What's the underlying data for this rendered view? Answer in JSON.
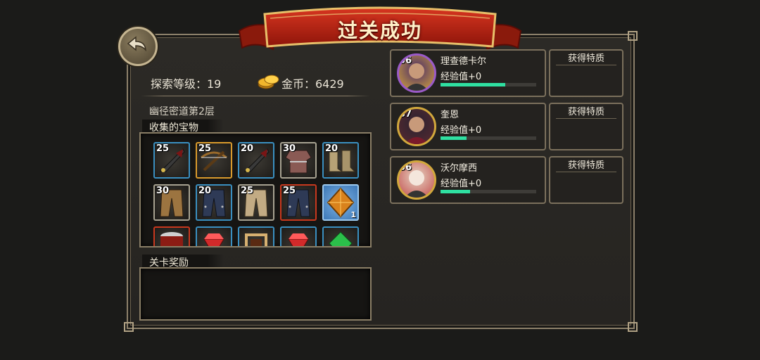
{
  "banner": {
    "title": "过关成功"
  },
  "header": {
    "explore_level": "探索等级：19",
    "gold_label": "金币：6429"
  },
  "stage": {
    "name": "幽径密道第2层"
  },
  "treasures": {
    "label": "收集的宝物",
    "items": [
      {
        "level": "25",
        "rarity": "blue",
        "kind": "weapon"
      },
      {
        "level": "25",
        "rarity": "gold",
        "kind": "crossbow"
      },
      {
        "level": "20",
        "rarity": "blue",
        "kind": "weapon"
      },
      {
        "level": "30",
        "rarity": "gray",
        "kind": "armor"
      },
      {
        "level": "20",
        "rarity": "blue",
        "kind": "boots"
      },
      {
        "level": "30",
        "rarity": "gray",
        "kind": "pants-brown"
      },
      {
        "level": "20",
        "rarity": "blue",
        "kind": "pants-dark"
      },
      {
        "level": "25",
        "rarity": "gray",
        "kind": "pants-light"
      },
      {
        "level": "25",
        "rarity": "red",
        "kind": "pants-dark"
      },
      {
        "level": "",
        "rarity": "bright",
        "kind": "amber-gem",
        "count": "1"
      },
      {
        "level": "",
        "rarity": "red",
        "kind": "red-drum"
      },
      {
        "level": "",
        "rarity": "blue",
        "kind": "ruby"
      },
      {
        "level": "",
        "rarity": "blue",
        "kind": "frame"
      },
      {
        "level": "",
        "rarity": "blue",
        "kind": "ruby"
      },
      {
        "level": "",
        "rarity": "blue",
        "kind": "emerald"
      }
    ]
  },
  "rewards": {
    "label": "关卡奖励"
  },
  "heroes": [
    {
      "level": "36",
      "name": "理查德卡尔",
      "exp": "经验值+0",
      "exp_fraction": 0.68,
      "feature_label": "获得特质"
    },
    {
      "level": "37",
      "name": "奎恩",
      "exp": "经验值+0",
      "exp_fraction": 0.27,
      "feature_label": "获得特质"
    },
    {
      "level": "36",
      "name": "沃尔摩西",
      "exp": "经验值+0",
      "exp_fraction": 0.31,
      "feature_label": "获得特质"
    }
  ],
  "colors": {
    "accent_bar": "#2fe0a1",
    "banner_red": "#b8210f",
    "frame": "#8c806a"
  },
  "icons": {
    "back": "back-arrow-icon",
    "gold": "gold-coins-icon"
  }
}
